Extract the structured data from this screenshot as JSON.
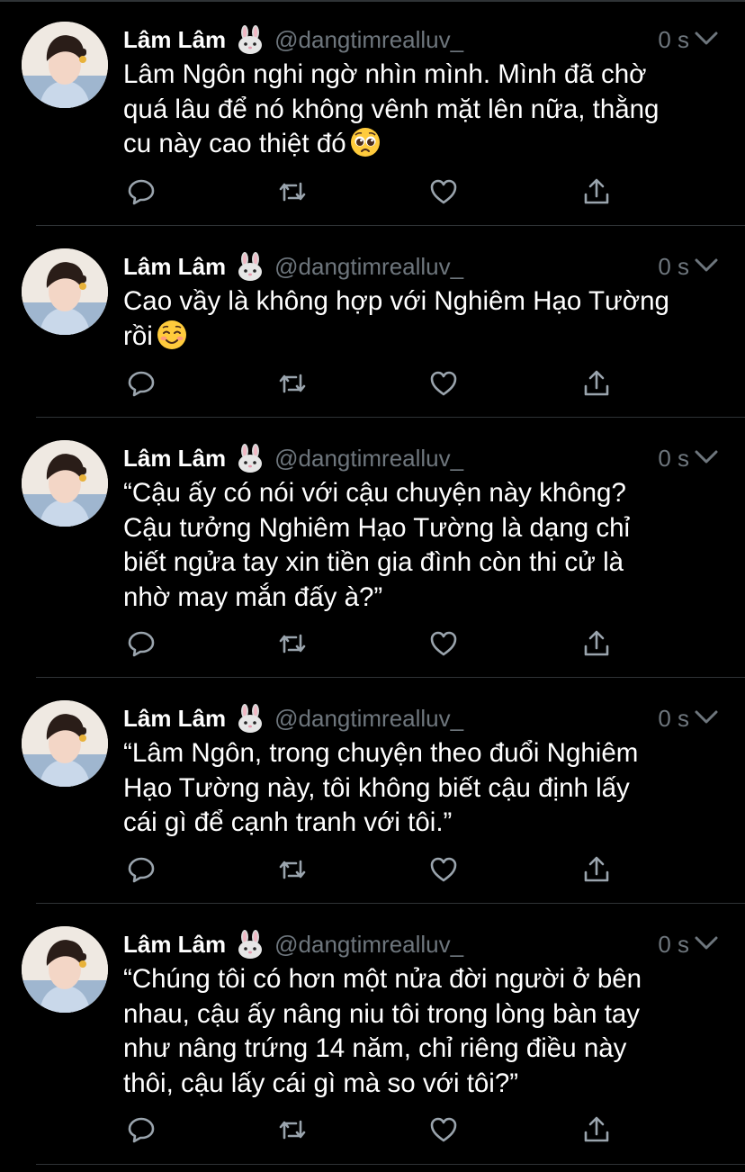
{
  "tweets": [
    {
      "name": "Lâm Lâm",
      "handle": "@dangtimrealluv_",
      "time": "0 s",
      "text": "Lâm Ngôn nghi ngờ nhìn mình. Mình đã chờ\nquá lâu để nó không vênh mặt lên nữa, thằng\ncu này cao thiệt đó",
      "emoji": "pleading-face-emoji"
    },
    {
      "name": "Lâm Lâm",
      "handle": "@dangtimrealluv_",
      "time": "0 s",
      "text": "Cao vầy là không hợp với Nghiêm Hạo Tường\nrồi",
      "emoji": "smiling-face-emoji"
    },
    {
      "name": "Lâm Lâm",
      "handle": "@dangtimrealluv_",
      "time": "0 s",
      "text": "“Cậu ấy có nói với cậu chuyện này không?\nCậu tưởng Nghiêm Hạo Tường là dạng chỉ\nbiết ngửa tay xin tiền gia đình còn thi cử là\nnhờ may mắn đấy à?”",
      "emoji": ""
    },
    {
      "name": "Lâm Lâm",
      "handle": "@dangtimrealluv_",
      "time": "0 s",
      "text": "“Lâm Ngôn, trong chuyện theo đuổi Nghiêm\nHạo Tường này, tôi không biết cậu định lấy\ncái gì để cạnh tranh với tôi.”",
      "emoji": ""
    },
    {
      "name": "Lâm Lâm",
      "handle": "@dangtimrealluv_",
      "time": "0 s",
      "text": "“Chúng tôi có hơn một nửa đời người ở bên\nnhau, cậu ấy nâng niu tôi trong lòng bàn tay\nnhư nâng trứng 14 năm, chỉ riêng điều này\nthôi, cậu lấy cái gì mà so với tôi?”",
      "emoji": ""
    }
  ],
  "icons": {
    "reply": "reply-icon",
    "retweet": "retweet-icon",
    "like": "like-icon",
    "share": "share-icon",
    "caret": "chevron-down-icon",
    "badge": "rabbit-face-emoji"
  },
  "colors": {
    "background": "#000000",
    "text": "#ffffff",
    "muted": "#6e767d",
    "separator": "#2f3336"
  }
}
